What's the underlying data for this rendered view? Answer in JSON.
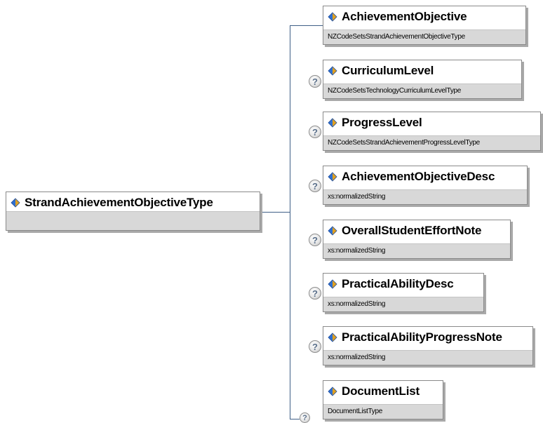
{
  "root": {
    "name": "StrandAchievementObjectiveType",
    "icon": "element-icon"
  },
  "children": [
    {
      "name": "AchievementObjective",
      "type": "NZCodeSetsStrandAchievementObjectiveType",
      "optional": false,
      "icon": "element-icon"
    },
    {
      "name": "CurriculumLevel",
      "type": "NZCodeSetsTechnologyCurriculumLevelType",
      "optional": true,
      "icon": "element-icon"
    },
    {
      "name": "ProgressLevel",
      "type": "NZCodeSetsStrandAchievementProgressLevelType",
      "optional": true,
      "icon": "element-icon"
    },
    {
      "name": "AchievementObjectiveDesc",
      "type": "xs:normalizedString",
      "optional": true,
      "icon": "element-icon"
    },
    {
      "name": "OverallStudentEffortNote",
      "type": "xs:normalizedString",
      "optional": true,
      "icon": "element-icon"
    },
    {
      "name": "PracticalAbilityDesc",
      "type": "xs:normalizedString",
      "optional": true,
      "icon": "element-icon"
    },
    {
      "name": "PracticalAbilityProgressNote",
      "type": "xs:normalizedString",
      "optional": true,
      "icon": "element-icon"
    },
    {
      "name": "DocumentList",
      "type": "DocumentListType",
      "optional": true,
      "icon": "element-icon"
    }
  ],
  "optional_marker": "?",
  "colors": {
    "connector": "#3f5f87",
    "icon_blue": "#2f6fd0",
    "icon_gold": "#e0a020",
    "type_band": "#d8d8d8"
  }
}
